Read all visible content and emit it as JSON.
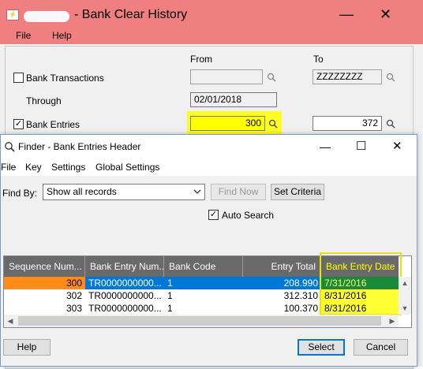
{
  "background_window": {
    "title": "- Bank Clear History",
    "app_icon_text": "⚡",
    "menu": [
      "File",
      "Help"
    ],
    "controls": {
      "minimize": "—",
      "close": "✕"
    },
    "columns": {
      "from": "From",
      "to": "To"
    },
    "bank_transactions": {
      "label": "Bank Transactions",
      "checked": false,
      "from_value": "",
      "to_value": "ZZZZZZZZ"
    },
    "through": {
      "label": "Through",
      "value": "02/01/2018"
    },
    "bank_entries": {
      "label": "Bank Entries",
      "checked": true,
      "check_mark": "✓",
      "from_value": "300",
      "to_value": "372"
    }
  },
  "finder": {
    "title": "Finder - Bank Entries Header",
    "controls": {
      "minimize": "—",
      "maximize": "☐",
      "close": "✕"
    },
    "menu": [
      "File",
      "Key",
      "Settings",
      "Global Settings"
    ],
    "find_by_label": "Find By:",
    "find_by_value": "Show all records",
    "find_now_label": "Find Now",
    "set_criteria_label": "Set Criteria",
    "auto_search": {
      "label": "Auto Search",
      "checked": true,
      "check_mark": "✓"
    },
    "grid": {
      "columns": [
        "Sequence Num...",
        "Bank Entry Num...",
        "Bank Code",
        "Entry Total",
        "Bank Entry Date"
      ],
      "rows": [
        {
          "seq": "300",
          "entry_num": "TR0000000000...",
          "bank_code": "1",
          "total": "208.990",
          "date": "7/31/2016",
          "selected": true
        },
        {
          "seq": "302",
          "entry_num": "TR0000000000...",
          "bank_code": "1",
          "total": "312.310",
          "date": "8/31/2016",
          "selected": false
        },
        {
          "seq": "303",
          "entry_num": "TR0000000000...",
          "bank_code": "1",
          "total": "100.370",
          "date": "8/31/2016",
          "selected": false
        }
      ]
    },
    "buttons": {
      "help": "Help",
      "select": "Select",
      "cancel": "Cancel"
    }
  },
  "colors": {
    "title_bar": "#f08080",
    "highlight": "#ffff00",
    "selection": "#0078d7",
    "selected_key_cell": "#ff8c1a",
    "selected_date_cell": "#1a8a3a",
    "grid_header": "#6a6a6a"
  }
}
